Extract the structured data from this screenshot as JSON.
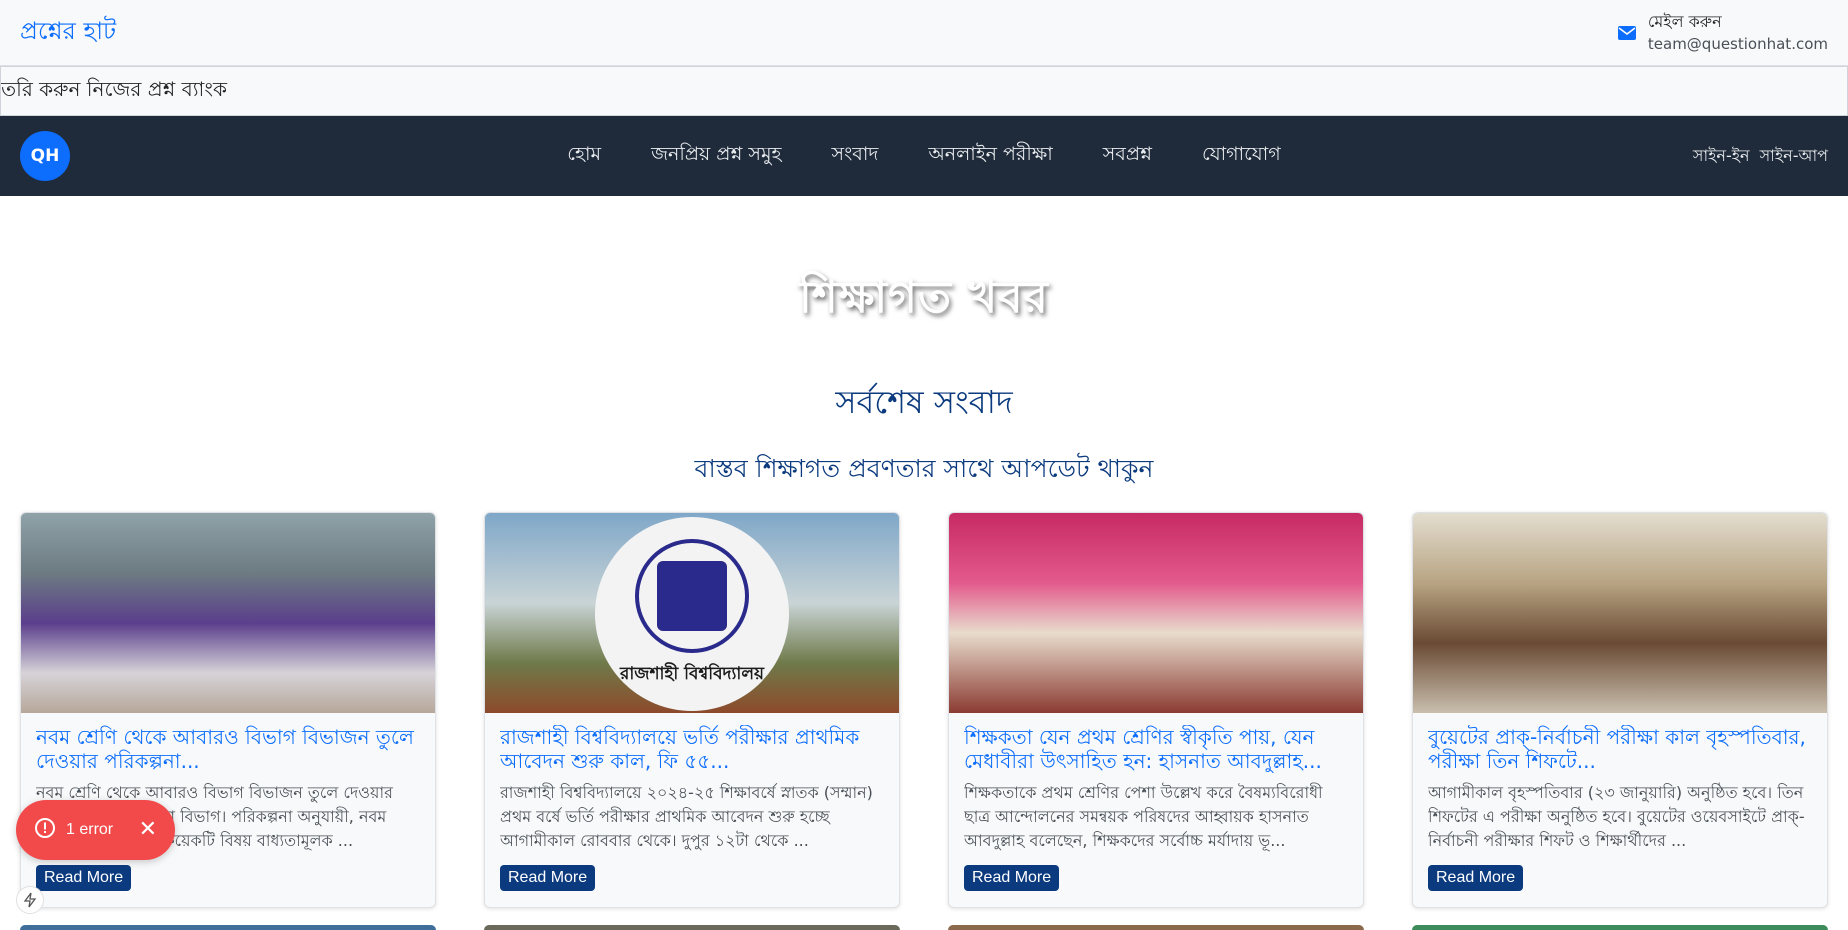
{
  "header": {
    "brand": "প্রশ্নের হাট",
    "mail_label": "মেইল করুন",
    "mail_email": "team@questionhat.com"
  },
  "marquee": {
    "text": "তৈরি করুন নিজের প্রশ্ন ব্যাংক"
  },
  "nav": {
    "logo": "QH",
    "links": [
      "হোম",
      "জনপ্রিয় প্রশ্ন সমুহ",
      "সংবাদ",
      "অনলাইন পরীক্ষা",
      "সবপ্রশ্ন",
      "যোগাযোগ"
    ],
    "sign_in": "সাইন-ইন",
    "sign_up": "সাইন-আপ"
  },
  "hero": {
    "title": "শিক্ষাগত খবর"
  },
  "section": {
    "title": "সর্বশেষ সংবাদ",
    "subtitle": "বাস্তব শিক্ষাগত প্রবণতার সাথে আপডেট থাকুন"
  },
  "cards": [
    {
      "title": "নবম শ্রেণি থেকে আবারও বিভাগ বিভাজন তুলে দেওয়ার পরিকল্পনা...",
      "excerpt": "নবম শ্রেণি থেকে আবারও বিভাগ বিভাজন তুলে দেওয়ার পরিকল্পনা করছে শিক্ষা বিভাগ। পরিকল্পনা অনুযায়ী, নবম শ্রেণিতে সবার জন্য কয়েকটি বিষয় বাধ্যতামূলক ...",
      "button": "Read More"
    },
    {
      "title": "রাজশাহী বিশ্ববিদ্যালয়ে ভর্তি পরীক্ষার প্রাথমিক আবেদন শুরু কাল, ফি ৫৫...",
      "excerpt": "রাজশাহী বিশ্ববিদ্যালয়ে ২০২৪-২৫ শিক্ষাবর্ষে স্নাতক (সম্মান) প্রথম বর্ষে ভর্তি পরীক্ষার প্রাথমিক আবেদন শুরু হচ্ছে আগামীকাল রোববার থেকে। দুপুর ১২টা থেকে ...",
      "button": "Read More",
      "image_text": "রাজশাহী বিশ্ববিদ্যালয়"
    },
    {
      "title": "শিক্ষকতা যেন প্রথম শ্রেণির স্বীকৃতি পায়, যেন মেধাবীরা উৎসাহিত হন: হাসনাত আবদুল্লাহ...",
      "excerpt": "শিক্ষকতাকে প্রথম শ্রেণির পেশা উল্লেখ করে বৈষম্যবিরোধী ছাত্র আন্দোলনের সমন্বয়ক পরিষদের আহ্বায়ক হাসনাত আবদুল্লাহ বলেছেন, শিক্ষকদের সর্বোচ্চ মর্যাদায় ভূ...",
      "button": "Read More"
    },
    {
      "title": "বুয়েটের প্রাক্-নির্বাচনী পরীক্ষা কাল বৃহস্পতিবার, পরীক্ষা তিন শিফটে...",
      "excerpt": "আগামীকাল বৃহস্পতিবার (২৩ জানুয়ারি) অনুষ্ঠিত হবে। তিন শিফটের এ পরীক্ষা অনুষ্ঠিত হবে। বুয়েটের ওয়েবসাইটে প্রাক্-নির্বাচনী পরীক্ষার শিফট ও শিক্ষার্থীদের ...",
      "button": "Read More"
    }
  ],
  "error_toast": {
    "text": "1 error"
  },
  "colors": {
    "navbar": "#1f2a3a",
    "brand": "#0d6efd",
    "heading": "#0b3a7e",
    "error": "#f24a4a"
  }
}
